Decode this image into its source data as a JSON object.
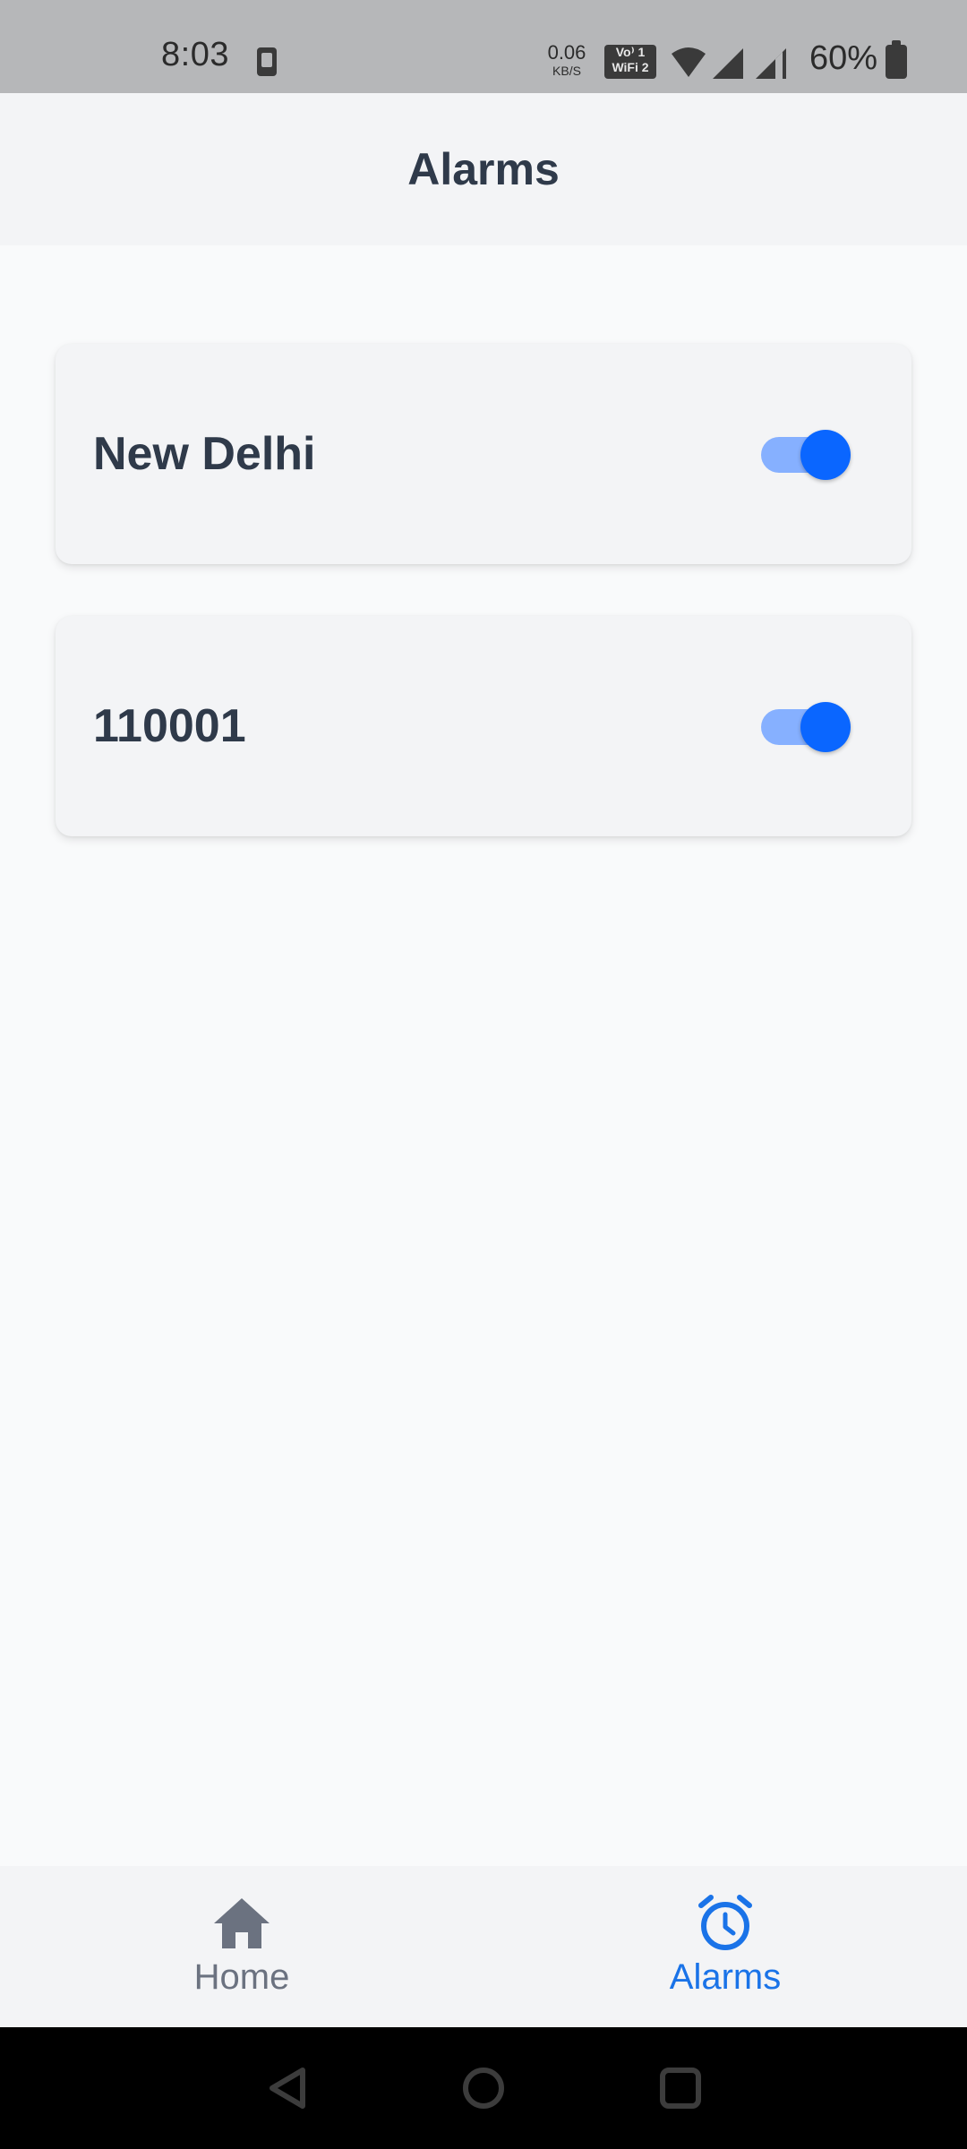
{
  "status_bar": {
    "time": "8:03",
    "network_speed_value": "0.06",
    "network_speed_unit": "KB/S",
    "vowifi_line1": "Vo⁾ 1",
    "vowifi_line2": "WiFi 2",
    "battery_percent": "60%",
    "icons": [
      "download-notification-icon",
      "vowifi-icon",
      "wifi-icon",
      "cell-signal-icon",
      "cell-signal-icon",
      "battery-icon"
    ]
  },
  "header": {
    "title": "Alarms"
  },
  "alarms": [
    {
      "label": "New Delhi",
      "enabled": true
    },
    {
      "label": "110001",
      "enabled": true
    }
  ],
  "bottom_nav": {
    "items": [
      {
        "label": "Home",
        "icon": "home-icon",
        "active": false
      },
      {
        "label": "Alarms",
        "icon": "alarm-clock-icon",
        "active": true
      }
    ]
  },
  "system_nav": {
    "icons": [
      "back-icon",
      "home-circle-icon",
      "recents-square-icon"
    ]
  },
  "colors": {
    "accent": "#1a73e8",
    "toggle_knob": "#0a66ff",
    "toggle_track": "#86b0ff",
    "inactive_nav": "#6b7280",
    "text_primary": "#2f3a4a",
    "background": "#f9fafb",
    "surface": "#f3f4f6"
  }
}
